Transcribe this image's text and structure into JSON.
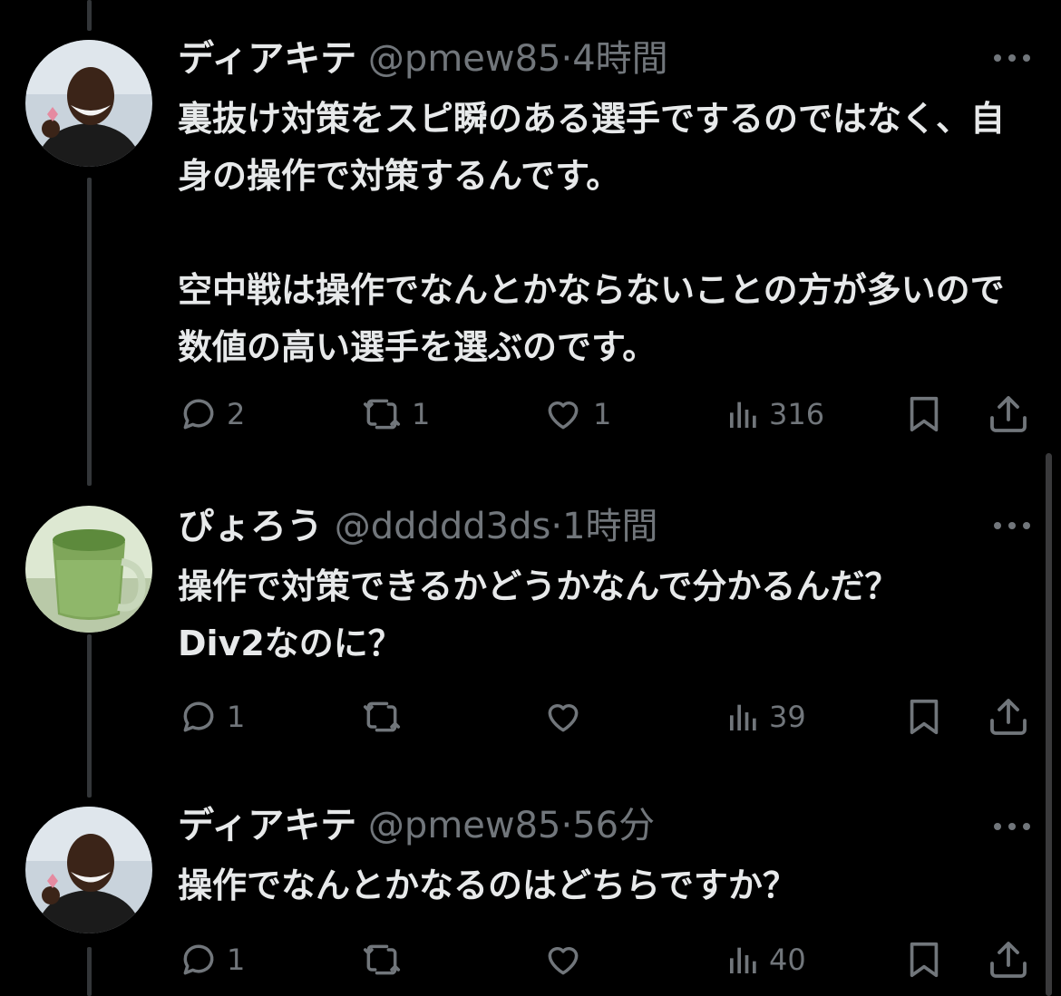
{
  "tweets": [
    {
      "name": "ディアキテ",
      "handle": "@pmew85",
      "time": "4時間",
      "paragraphs": [
        "裏抜け対策をスピ瞬のある選手でするのではなく、自身の操作で対策するんです。",
        "空中戦は操作でなんとかならないことの方が多いので数値の高い選手を選ぶのです。"
      ],
      "avatar_icon": "person-avatar",
      "replies": "2",
      "retweets": "1",
      "likes": "1",
      "views": "316"
    },
    {
      "name": "ぴょろう",
      "handle": "@ddddd3ds",
      "time": "1時間",
      "paragraphs": [
        "操作で対策できるかどうかなんで分かるんだ？Div2なのに？"
      ],
      "avatar_icon": "matcha-drink-avatar",
      "replies": "1",
      "retweets": "",
      "likes": "",
      "views": "39"
    },
    {
      "name": "ディアキテ",
      "handle": "@pmew85",
      "time": "56分",
      "paragraphs": [
        "操作でなんとかなるのはどちらですか？"
      ],
      "avatar_icon": "person-avatar",
      "replies": "1",
      "retweets": "",
      "likes": "",
      "views": "40"
    }
  ],
  "separator": "·",
  "colors": {
    "background": "#000000",
    "text": "#e7e9ea",
    "muted": "#71767b",
    "thread_line": "#333639"
  }
}
